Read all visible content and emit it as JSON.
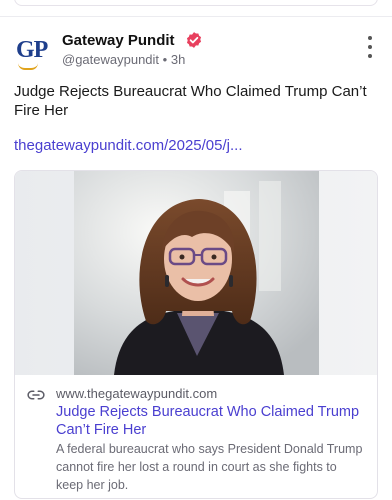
{
  "post": {
    "author_name": "Gateway Pundit",
    "logo_text": "GP",
    "handle": "@gatewaypundit",
    "separator": "•",
    "time_ago": "3h",
    "text": "Judge Rejects Bureaucrat Who Claimed Trump Can’t Fire Her",
    "link_text": "thegatewaypundit.com/2025/05/j..."
  },
  "link_card": {
    "domain": "www.thegatewaypundit.com",
    "title": "Judge Rejects Bureaucrat Who Claimed Trump Can’t Fire Her",
    "description": "A federal bureaucrat who says President Donald Trump cannot fire her lost a round in court as she fights to keep her job."
  },
  "icons": {
    "verified": "verified-badge-icon",
    "more": "more-vertical-icon",
    "link": "link-icon"
  },
  "colors": {
    "link": "#4a3fd0",
    "verified_badge": "#e8405e",
    "logo_blue": "#1f3f8c",
    "logo_gold": "#e0a31c"
  }
}
